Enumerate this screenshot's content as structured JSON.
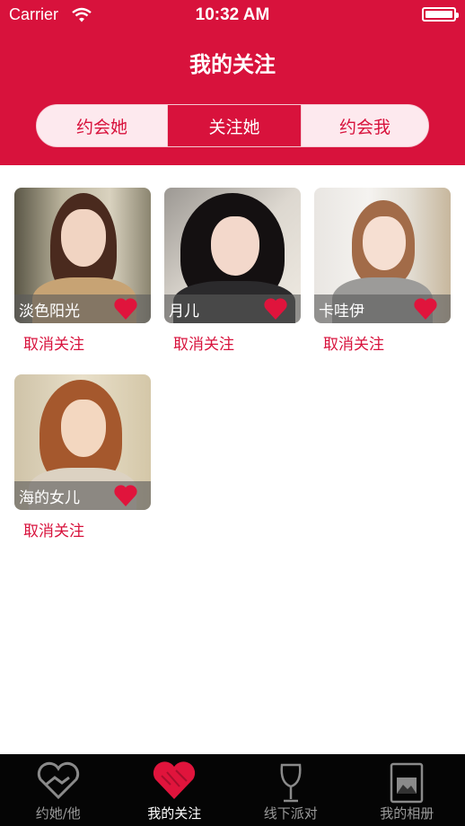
{
  "status_bar": {
    "carrier": "Carrier",
    "time": "10:32 AM"
  },
  "nav": {
    "title": "我的关注"
  },
  "segments": [
    {
      "label": "约会她",
      "selected": false
    },
    {
      "label": "关注她",
      "selected": true
    },
    {
      "label": "约会我",
      "selected": false
    }
  ],
  "cards": [
    {
      "name": "淡色阳光",
      "action": "取消关注"
    },
    {
      "name": "月儿",
      "action": "取消关注"
    },
    {
      "name": "卡哇伊",
      "action": "取消关注"
    },
    {
      "name": "海的女儿",
      "action": "取消关注"
    }
  ],
  "tabs": [
    {
      "label": "约她/他",
      "icon": "handshake-heart-icon",
      "active": false
    },
    {
      "label": "我的关注",
      "icon": "heart-icon",
      "active": true
    },
    {
      "label": "线下派对",
      "icon": "wine-glass-icon",
      "active": false
    },
    {
      "label": "我的相册",
      "icon": "photo-album-icon",
      "active": false
    }
  ],
  "colors": {
    "brand": "#d8123c",
    "heart": "#e0143c",
    "tabbar": "#050505"
  }
}
